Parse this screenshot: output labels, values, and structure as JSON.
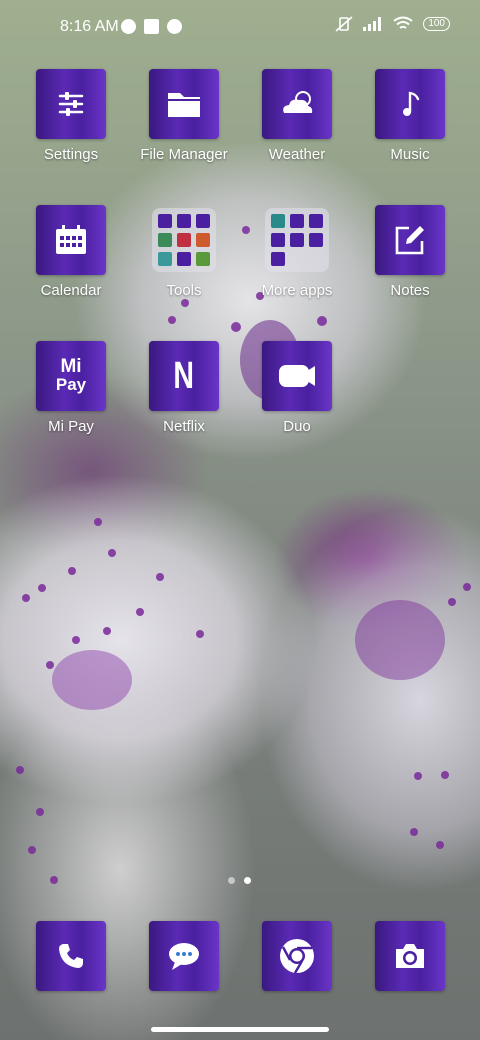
{
  "status_bar": {
    "time": "8:16 AM",
    "battery": "100"
  },
  "apps": [
    {
      "label": "Settings",
      "icon": "sliders-icon"
    },
    {
      "label": "File Manager",
      "icon": "folder-icon"
    },
    {
      "label": "Weather",
      "icon": "cloud-moon-icon"
    },
    {
      "label": "Music",
      "icon": "music-note-icon"
    },
    {
      "label": "Calendar",
      "icon": "calendar-icon"
    },
    {
      "label": "Tools",
      "icon": "folder-grid-icon"
    },
    {
      "label": "More apps",
      "icon": "folder-grid-icon"
    },
    {
      "label": "Notes",
      "icon": "note-edit-icon"
    },
    {
      "label": "Mi Pay",
      "icon": "mi-pay-icon",
      "logo_line1": "Mi",
      "logo_line2": "Pay"
    },
    {
      "label": "Netflix",
      "icon": "netflix-icon",
      "logo": "N"
    },
    {
      "label": "Duo",
      "icon": "video-camera-icon"
    }
  ],
  "dock": [
    {
      "icon": "phone-icon"
    },
    {
      "icon": "message-icon"
    },
    {
      "icon": "chrome-icon"
    },
    {
      "icon": "camera-icon"
    }
  ],
  "page_indicator": {
    "pages": 2,
    "current": 2
  },
  "colors": {
    "tile": "#4a20a0",
    "text": "#ffffff"
  }
}
